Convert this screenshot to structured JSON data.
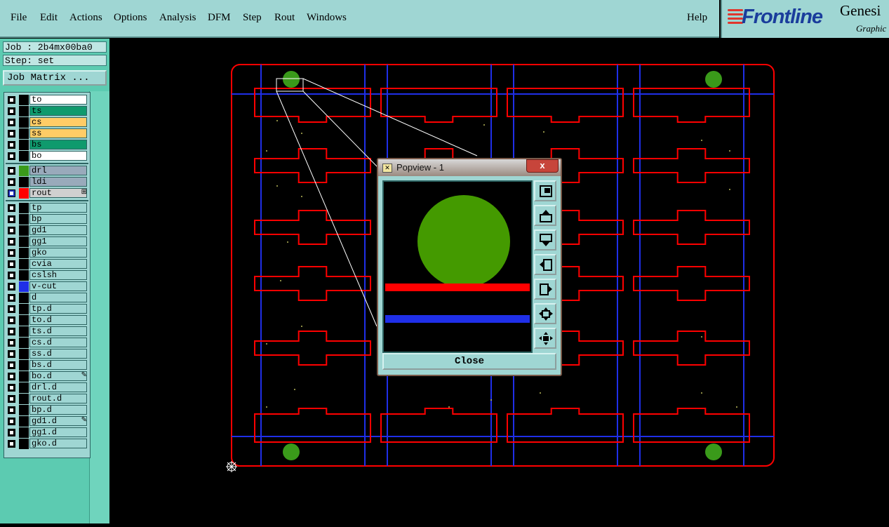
{
  "menubar": {
    "items": [
      {
        "label": "File"
      },
      {
        "label": "Edit"
      },
      {
        "label": "Actions"
      },
      {
        "label": "Options"
      },
      {
        "label": "Analysis"
      },
      {
        "label": "DFM"
      },
      {
        "label": "Step"
      },
      {
        "label": "Rout"
      },
      {
        "label": "Windows"
      }
    ],
    "help": "Help"
  },
  "logo": {
    "brand": "Frontline",
    "product": "Genesi",
    "subtitle": "Graphic",
    "colors": {
      "brand": "#1a3d9c",
      "lines": "#e0362d"
    }
  },
  "job": {
    "job_line": "Job : 2b4mx00ba0",
    "step_line": "Step: set",
    "matrix_button": "Job Matrix ..."
  },
  "layers": {
    "group1": [
      {
        "name": "to",
        "bg": "#ffffff"
      },
      {
        "name": "ts",
        "bg": "#0f9a6d"
      },
      {
        "name": "cs",
        "bg": "#ffcc66"
      },
      {
        "name": "ss",
        "bg": "#ffcc66"
      },
      {
        "name": "bs",
        "bg": "#0f9a6d"
      },
      {
        "name": "bo",
        "bg": "#ffffff"
      }
    ],
    "group2": [
      {
        "name": "drl",
        "bg": "#99aabb",
        "swatch": "#3a9a1a"
      },
      {
        "name": "ldi",
        "bg": "#99aabb"
      },
      {
        "name": "rout",
        "bg": "#d0d0d0",
        "swatch": "#ff0000",
        "checked": true,
        "mark": "⊞"
      }
    ],
    "group3": [
      {
        "name": "tp"
      },
      {
        "name": "bp"
      },
      {
        "name": "gd1"
      },
      {
        "name": "gg1"
      },
      {
        "name": "gko"
      },
      {
        "name": "cvia"
      },
      {
        "name": "cslsh"
      },
      {
        "name": "v-cut",
        "swatch": "#1f2fe8"
      },
      {
        "name": "d"
      },
      {
        "name": "tp.d"
      },
      {
        "name": "to.d"
      },
      {
        "name": "ts.d"
      },
      {
        "name": "cs.d"
      },
      {
        "name": "ss.d"
      },
      {
        "name": "bs.d"
      },
      {
        "name": "bo.d",
        "mark": "✎"
      },
      {
        "name": "drl.d"
      },
      {
        "name": "rout.d"
      },
      {
        "name": "bp.d"
      },
      {
        "name": "gd1.d",
        "mark": "✎"
      },
      {
        "name": "gg1.d"
      },
      {
        "name": "gko.d"
      }
    ]
  },
  "popview": {
    "title": "Popview - 1",
    "close_x": "x",
    "close_button": "Close",
    "tools": [
      "zoom-fit-icon",
      "pan-up-icon",
      "pan-down-icon",
      "pan-left-icon",
      "pan-right-icon",
      "zoom-out-icon",
      "zoom-in-icon"
    ]
  },
  "colors": {
    "rout": "#ff0000",
    "vcut": "#1f2fe8",
    "drill": "#3a9a1a",
    "panel_bg": "#9fd6d3",
    "side_panel": "#5ccbb1"
  }
}
